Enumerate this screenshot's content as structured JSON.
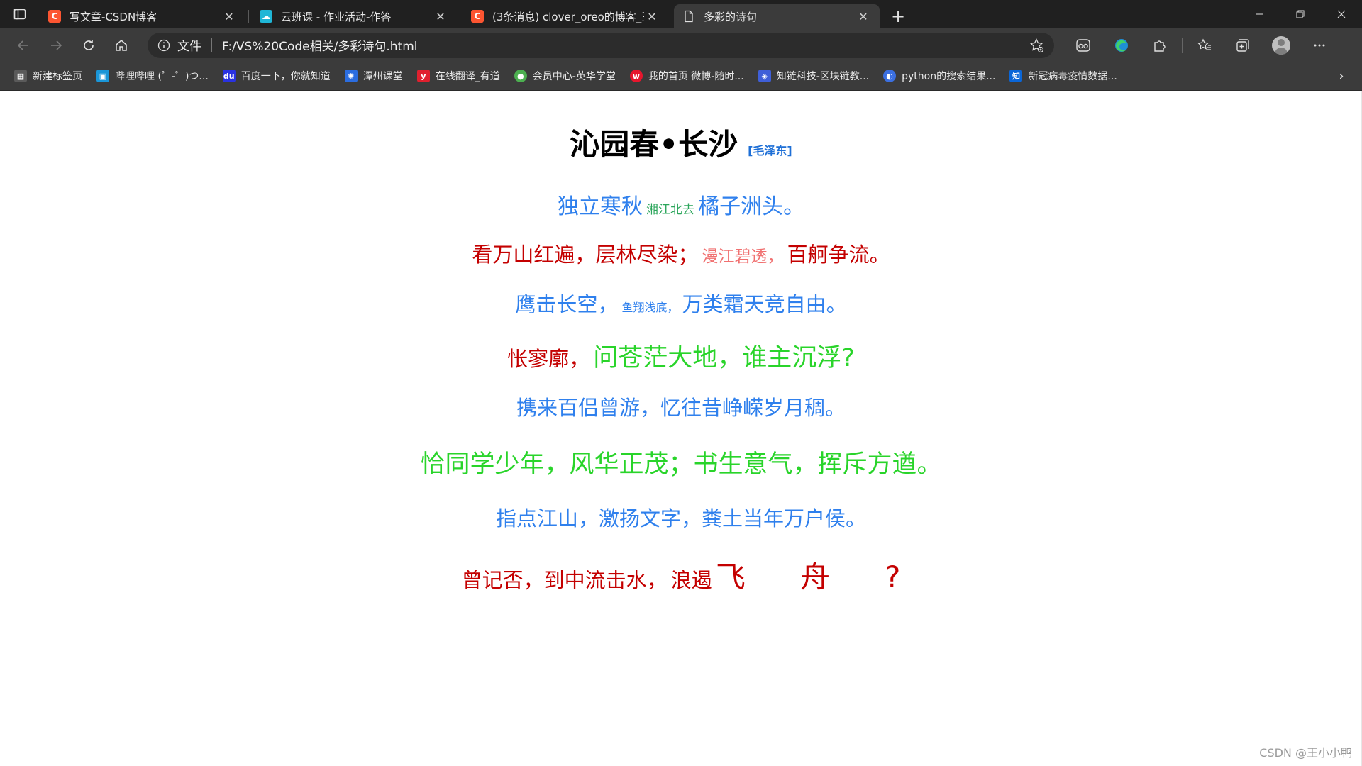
{
  "tabs": [
    {
      "title": "写文章-CSDN博客",
      "favicon_letter": "C",
      "favicon_color": "#fc5531",
      "active": false
    },
    {
      "title": "云班课 - 作业活动-作答",
      "favicon_letter": "☁",
      "favicon_color": "#1fb6d6",
      "active": false
    },
    {
      "title": "(3条消息) clover_oreo的博客_王小",
      "favicon_letter": "C",
      "favicon_color": "#fc5531",
      "active": false
    },
    {
      "title": "多彩的诗句",
      "favicon_letter": "",
      "favicon_color": "#3b3b3b",
      "active": true
    }
  ],
  "address": {
    "scheme_label": "文件",
    "url": "F:/VS%20Code相关/多彩诗句.html"
  },
  "bookmarks": [
    {
      "label": "新建标签页",
      "icon_color": "#5a5a5a",
      "icon_text": "▦"
    },
    {
      "label": "哔哩哔哩 (゜-゜)つ...",
      "icon_color": "#1a96d8",
      "icon_text": "▣"
    },
    {
      "label": "百度一下，你就知道",
      "icon_color": "#2932e1",
      "icon_text": "du"
    },
    {
      "label": "潭州课堂",
      "icon_color": "#2b6de0",
      "icon_text": "✺"
    },
    {
      "label": "在线翻译_有道",
      "icon_color": "#e0202e",
      "icon_text": "y"
    },
    {
      "label": "会员中心-英华学堂",
      "icon_color": "#4caf50",
      "icon_text": "●"
    },
    {
      "label": "我的首页 微博-随时...",
      "icon_color": "#e6162d",
      "icon_text": "w"
    },
    {
      "label": "知链科技-区块链教...",
      "icon_color": "#3f5fd8",
      "icon_text": "◈"
    },
    {
      "label": "python的搜索结果...",
      "icon_color": "#3b6fe0",
      "icon_text": "◐"
    },
    {
      "label": "新冠病毒疫情数据...",
      "icon_color": "#0a66d8",
      "icon_text": "知"
    }
  ],
  "poem": {
    "title": "沁园春•长沙",
    "author": "[毛泽东]",
    "lines": [
      {
        "segments": [
          {
            "text": "独立寒秋",
            "color": "blue",
            "size": 30
          },
          {
            "text": "湘江北去",
            "color": "small-green",
            "size": 17
          },
          {
            "text": "橘子洲头。",
            "color": "blue",
            "size": 30
          }
        ]
      },
      {
        "segments": [
          {
            "text": "看万山红遍，层林尽染；",
            "color": "red",
            "size": 29
          },
          {
            "text": "漫江碧透，",
            "color": "pink",
            "size": 23
          },
          {
            "text": "百舸争流。",
            "color": "red",
            "size": 29
          }
        ]
      },
      {
        "segments": [
          {
            "text": "鹰击长空，",
            "color": "blue",
            "size": 29
          },
          {
            "text": "鱼翔浅底，",
            "color": "blue",
            "size": 16
          },
          {
            "text": "万类霜天竞自由。",
            "color": "blue",
            "size": 29
          }
        ]
      },
      {
        "segments": [
          {
            "text": "怅寥廓，",
            "color": "red",
            "size": 29
          },
          {
            "text": "问苍茫大地，谁主沉浮?",
            "color": "green",
            "size": 35
          }
        ]
      },
      {
        "segments": [
          {
            "text": "携来百侣曾游，忆往昔峥嵘岁月稠。",
            "color": "blue",
            "size": 29
          }
        ]
      },
      {
        "segments": [
          {
            "text": "恰同学少年，风华正茂；书生意气，挥斥方遒。",
            "color": "green",
            "size": 35
          }
        ]
      },
      {
        "segments": [
          {
            "text": "指点江山，激扬文字，粪土当年万户侯。",
            "color": "blue",
            "size": 29
          }
        ]
      },
      {
        "segments": [
          {
            "text": "曾记否，到中流击水，",
            "color": "red",
            "size": 29
          },
          {
            "text": "浪遏",
            "color": "red",
            "size": 29
          },
          {
            "text": "飞",
            "color": "red",
            "size": 42
          },
          {
            "text": "舟",
            "color": "red",
            "size": 42
          },
          {
            "text": "?",
            "color": "red",
            "size": 42
          }
        ]
      }
    ]
  },
  "watermark": "CSDN @王小小鸭"
}
